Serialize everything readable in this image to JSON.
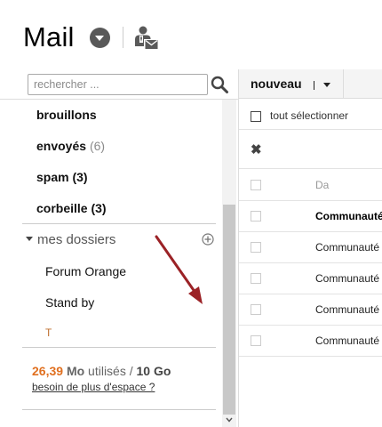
{
  "header": {
    "title": "Mail",
    "menu_icon": "chevron-down-circle-icon",
    "contacts_icon": "contacts-icon"
  },
  "sidebar": {
    "search": {
      "placeholder": "rechercher ...",
      "value": ""
    },
    "folders": [
      {
        "label": "brouillons",
        "count": ""
      },
      {
        "label": "envoyés",
        "count": "(6)"
      },
      {
        "label": "spam",
        "count": "(3)"
      },
      {
        "label": "corbeille",
        "count": "(3)"
      }
    ],
    "my_folders": {
      "label": "mes dossiers",
      "items": [
        {
          "label": "Forum Orange"
        },
        {
          "label": "Stand by"
        },
        {
          "label": "T"
        }
      ]
    },
    "storage": {
      "used": "26,39",
      "used_unit": "Mo",
      "used_label": "utilisés /",
      "total": "10 Go",
      "more_link": "besoin de plus d'espace ?"
    }
  },
  "main": {
    "toolbar": {
      "new_label": "nouveau"
    },
    "select_all_label": "tout sélectionner",
    "close_symbol": "✖",
    "messages": [
      {
        "sender": "Da",
        "unread": false
      },
      {
        "sender": "Communauté",
        "unread": true
      },
      {
        "sender": "Communauté",
        "unread": false
      },
      {
        "sender": "Communauté",
        "unread": false
      },
      {
        "sender": "Communauté",
        "unread": false
      },
      {
        "sender": "Communauté",
        "unread": false
      }
    ]
  },
  "colors": {
    "accent_orange": "#e07020",
    "annotation_arrow": "#9b2226",
    "scroll_thumb": "#c8c8c8"
  }
}
